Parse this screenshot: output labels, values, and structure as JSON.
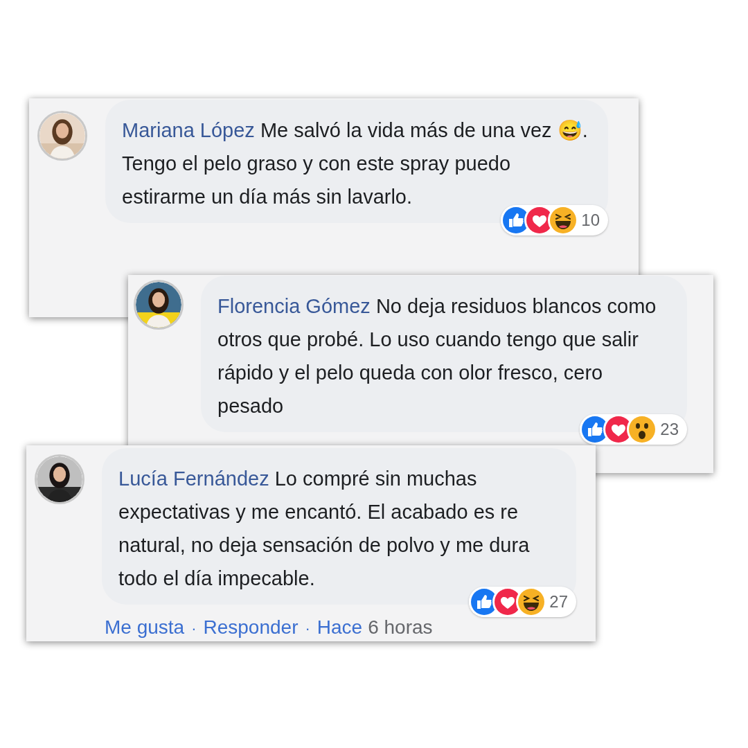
{
  "comments": [
    {
      "author": "Mariana López",
      "text": "Me salvó la vida más de una vez 😅. Tengo el pelo graso y con este spray puedo estirarme un día más sin lavarlo.",
      "reactions": [
        {
          "kind": "like"
        },
        {
          "kind": "love"
        },
        {
          "kind": "haha"
        }
      ],
      "reaction_count": "10"
    },
    {
      "author": "Florencia Gómez",
      "text": "No deja residuos blancos como otros que probé. Lo uso cuando tengo que salir rápido y el pelo queda con olor fresco, cero pesado",
      "reactions": [
        {
          "kind": "like"
        },
        {
          "kind": "love"
        },
        {
          "kind": "wow"
        }
      ],
      "reaction_count": "23"
    },
    {
      "author": "Lucía Fernández",
      "text": "Lo compré sin muchas expectativas y me encantó. El acabado es re natural, no deja sensación de polvo y me dura todo el día impecable.",
      "reactions": [
        {
          "kind": "like"
        },
        {
          "kind": "love"
        },
        {
          "kind": "haha"
        }
      ],
      "reaction_count": "27",
      "footer": [
        {
          "kind": "link",
          "text": "Me gusta"
        },
        {
          "kind": "separator",
          "text": "·"
        },
        {
          "kind": "link",
          "text": "Responder"
        },
        {
          "kind": "separator",
          "text": "·"
        },
        {
          "kind": "link",
          "text": "Hace"
        },
        {
          "kind": "time",
          "text": "6 horas"
        }
      ]
    }
  ]
}
